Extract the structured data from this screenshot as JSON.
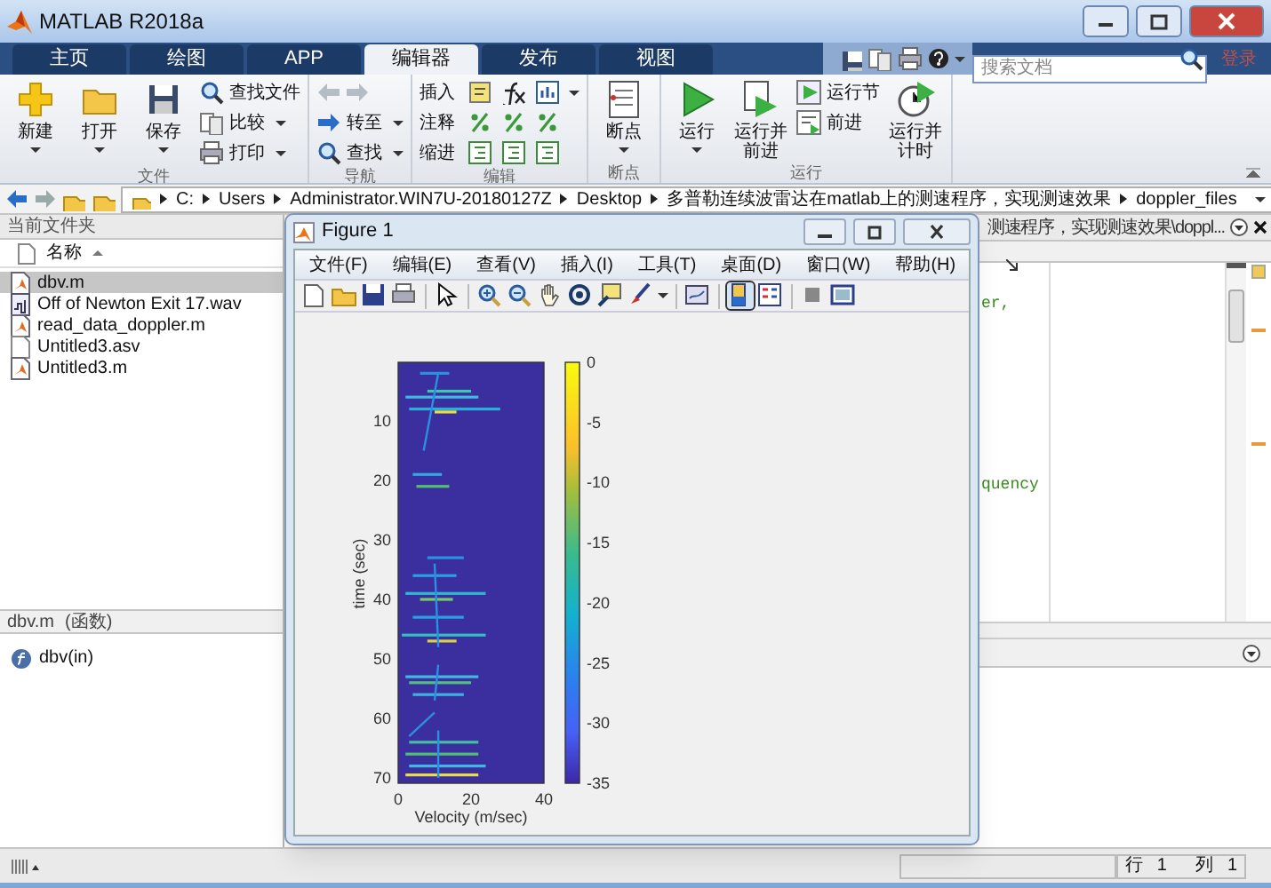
{
  "window": {
    "title": "MATLAB R2018a"
  },
  "tabs": [
    {
      "label": "主页",
      "selected": false
    },
    {
      "label": "绘图",
      "selected": false
    },
    {
      "label": "APP",
      "selected": false
    },
    {
      "label": "编辑器",
      "selected": true
    },
    {
      "label": "发布",
      "selected": false
    },
    {
      "label": "视图",
      "selected": false
    }
  ],
  "search": {
    "placeholder": "搜索文档"
  },
  "login": "登录",
  "toolstrip": [
    {
      "label": "文件",
      "items": [
        {
          "kind": "large",
          "label": "新建",
          "dropdown": true
        },
        {
          "kind": "large",
          "label": "打开",
          "dropdown": true
        },
        {
          "kind": "large",
          "label": "保存",
          "dropdown": true
        },
        {
          "kind": "small",
          "label": "查找文件",
          "dropdown": false
        },
        {
          "kind": "small",
          "label": "比较",
          "dropdown": true
        },
        {
          "kind": "small",
          "label": "打印",
          "dropdown": true
        }
      ]
    },
    {
      "label": "导航",
      "items": [
        {
          "kind": "arrows",
          "disabled": true
        },
        {
          "kind": "small",
          "label": "转至",
          "dropdown": true
        },
        {
          "kind": "small",
          "label": "查找",
          "dropdown": true
        }
      ]
    },
    {
      "label": "编辑",
      "items": [
        {
          "kind": "row",
          "label": "插入",
          "dropdown": true
        },
        {
          "kind": "row",
          "label": "注释",
          "dropdown": false
        },
        {
          "kind": "row",
          "label": "缩进",
          "dropdown": false
        }
      ]
    },
    {
      "label": "断点",
      "items": [
        {
          "kind": "large",
          "label": "断点",
          "dropdown": true
        }
      ]
    },
    {
      "label": "运行",
      "items": [
        {
          "kind": "large",
          "label": "运行",
          "dropdown": true
        },
        {
          "kind": "large",
          "label": "运行并前进",
          "dropdown": false
        },
        {
          "kind": "small",
          "label": "运行节",
          "dropdown": false
        },
        {
          "kind": "small",
          "label": "前进",
          "dropdown": false
        },
        {
          "kind": "large",
          "label": "运行并计时",
          "dropdown": false
        }
      ]
    }
  ],
  "address_bar": {
    "segments": [
      "C:",
      "Users",
      "Administrator.WIN7U-20180127Z",
      "Desktop",
      "多普勒连续波雷达在matlab上的测速程序，实现测速效果",
      "doppler_files"
    ]
  },
  "current_folder": {
    "title": "当前文件夹",
    "column": "名称",
    "files": [
      {
        "name": "dbv.m",
        "kind": "mfile",
        "selected": true
      },
      {
        "name": "Off of Newton Exit 17.wav",
        "kind": "audio",
        "selected": false
      },
      {
        "name": "read_data_doppler.m",
        "kind": "mfile",
        "selected": false
      },
      {
        "name": "Untitled3.asv",
        "kind": "plain",
        "selected": false
      },
      {
        "name": "Untitled3.m",
        "kind": "mfile",
        "selected": false
      }
    ]
  },
  "details": {
    "file": "dbv.m",
    "type": "(函数)",
    "items": [
      "dbv(in)"
    ]
  },
  "editor": {
    "title": "测速程序，实现测速效果\\doppl...",
    "code_fragments": [
      "er,",
      "quency"
    ]
  },
  "figure": {
    "title": "Figure 1",
    "menus": [
      "文件(F)",
      "编辑(E)",
      "查看(V)",
      "插入(I)",
      "工具(T)",
      "桌面(D)",
      "窗口(W)",
      "帮助(H)"
    ],
    "toolbar": [
      {
        "pressed": false
      },
      {
        "pressed": false
      },
      {
        "pressed": false
      },
      {
        "pressed": false
      },
      {
        "pressed": false
      },
      {
        "pressed": false
      },
      {
        "pressed": false
      },
      {
        "pressed": false
      },
      {
        "pressed": false
      },
      {
        "pressed": false
      },
      {
        "pressed": false
      },
      {
        "pressed": false
      },
      {
        "pressed": true
      },
      {
        "pressed": false
      },
      {
        "pressed": false
      },
      {
        "pressed": false
      }
    ],
    "plot": {
      "xlabel": "Velocity (m/sec)",
      "ylabel": "time (sec)",
      "xticks": [
        "0",
        "20",
        "40"
      ],
      "yticks": [
        "10",
        "20",
        "30",
        "40",
        "50",
        "60",
        "70"
      ],
      "colorbar_ticks": [
        "0",
        "-5",
        "-10",
        "-15",
        "-20",
        "-25",
        "-30",
        "-35"
      ]
    }
  },
  "status_bar": {
    "row_label": "行",
    "row": "1",
    "col_label": "列",
    "col": "1"
  }
}
